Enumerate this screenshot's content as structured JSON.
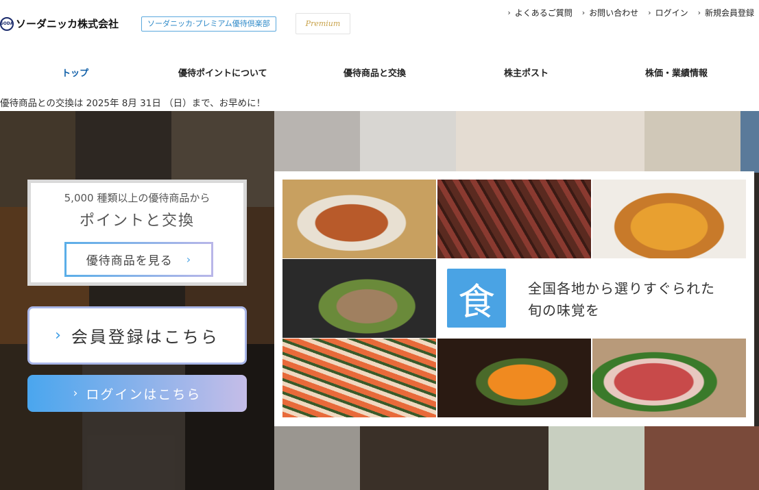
{
  "brand": {
    "logo_mark": "SODA",
    "logo_text": "ソーダニッカ株式会社",
    "club_badge": "ソーダニッカ·プレミアム優待倶楽部",
    "premium_badge": "Premium"
  },
  "util_nav": [
    {
      "label": "よくあるご質問"
    },
    {
      "label": "お問い合わせ"
    },
    {
      "label": "ログイン"
    },
    {
      "label": "新規会員登録"
    }
  ],
  "main_nav": [
    {
      "label": "トップ",
      "active": true
    },
    {
      "label": "優待ポイントについて"
    },
    {
      "label": "優待商品と交換"
    },
    {
      "label": "株主ポスト"
    },
    {
      "label": "株価・業績情報"
    }
  ],
  "notice": "優待商品との交換は 2025年 8月 31日 （日）まで、お早めに！",
  "hero": {
    "promo_line1": "5,000 種類以上の優待商品から",
    "promo_line2": "ポイントと交換",
    "promo_button": "優待商品を見る",
    "register_button": "会員登録はこちら",
    "login_button": "ログインはこちら",
    "food_icon_char": "食",
    "food_line1": "全国各地から選りすぐられた",
    "food_line2": "旬の味覚を"
  },
  "icons": {
    "chevron": "chevron-right-icon"
  },
  "colors": {
    "accent_blue": "#4aa3e4",
    "nav_active": "#0f5fa8",
    "badge_blue": "#2d89c8"
  }
}
